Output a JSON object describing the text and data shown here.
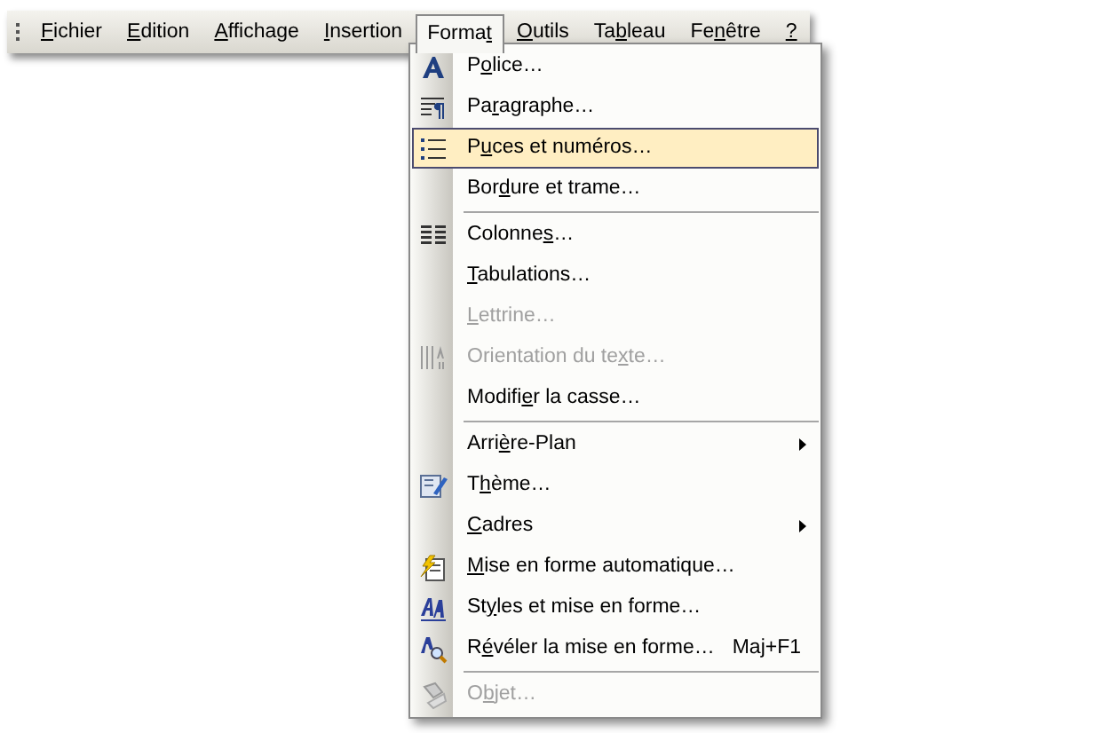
{
  "menu_bar": {
    "items": [
      {
        "label": {
          "key": "F",
          "after": "ichier"
        },
        "selected": false
      },
      {
        "label": {
          "key": "E",
          "after": "dition"
        },
        "selected": false
      },
      {
        "label": {
          "key": "A",
          "after": "ffichage"
        },
        "selected": false
      },
      {
        "label": {
          "key": "I",
          "after": "nsertion"
        },
        "selected": false
      },
      {
        "label": {
          "before": "Forma",
          "key": "t"
        },
        "selected": true
      },
      {
        "label": {
          "key": "O",
          "after": "utils"
        },
        "selected": false
      },
      {
        "label": {
          "before": "Ta",
          "key": "b",
          "after": "leau"
        },
        "selected": false
      },
      {
        "label": {
          "before": "Fe",
          "key": "n",
          "after": "être"
        },
        "selected": false
      },
      {
        "label": {
          "key": "?"
        },
        "selected": false
      }
    ]
  },
  "format_menu": {
    "items": [
      {
        "kind": "command",
        "label": {
          "before": "P",
          "key": "o",
          "after": "lice…"
        },
        "selected": false,
        "disabled": false
      },
      {
        "kind": "command",
        "label": {
          "before": "Pa",
          "key": "r",
          "after": "agraphe…"
        },
        "selected": false,
        "disabled": false
      },
      {
        "kind": "command",
        "label": {
          "before": "P",
          "key": "u",
          "after": "ces et numéros…"
        },
        "selected": true,
        "disabled": false
      },
      {
        "kind": "command",
        "label": {
          "before": "Bor",
          "key": "d",
          "after": "ure et trame…"
        },
        "selected": false,
        "disabled": false
      },
      {
        "kind": "separator"
      },
      {
        "kind": "command",
        "label": {
          "before": "Colonne",
          "key": "s",
          "after": "…"
        },
        "selected": false,
        "disabled": false
      },
      {
        "kind": "command",
        "label": {
          "key": "T",
          "after": "abulations…"
        },
        "selected": false,
        "disabled": false
      },
      {
        "kind": "command",
        "label": {
          "key": "L",
          "after": "ettrine…"
        },
        "selected": false,
        "disabled": true
      },
      {
        "kind": "command",
        "label": {
          "before": "Orientation du te",
          "key": "x",
          "after": "te…"
        },
        "selected": false,
        "disabled": true
      },
      {
        "kind": "command",
        "label": {
          "before": "Modifi",
          "key": "e",
          "after": "r la casse…"
        },
        "selected": false,
        "disabled": false
      },
      {
        "kind": "separator"
      },
      {
        "kind": "submenu",
        "label": {
          "before": "Arri",
          "key": "è",
          "after": "re-Plan"
        },
        "selected": false,
        "disabled": false
      },
      {
        "kind": "command",
        "label": {
          "before": "T",
          "key": "h",
          "after": "ème…"
        },
        "selected": false,
        "disabled": false
      },
      {
        "kind": "submenu",
        "label": {
          "key": "C",
          "after": "adres"
        },
        "selected": false,
        "disabled": false
      },
      {
        "kind": "command",
        "label": {
          "key": "M",
          "after": "ise en forme automatique…"
        },
        "selected": false,
        "disabled": false
      },
      {
        "kind": "command",
        "label": {
          "before": "St",
          "key": "y",
          "after": "les et mise en forme…"
        },
        "selected": false,
        "disabled": false
      },
      {
        "kind": "command",
        "label": {
          "before": "R",
          "key": "é",
          "after": "véler la mise en forme…"
        },
        "shortcut": "Maj+F1",
        "selected": false,
        "disabled": false
      },
      {
        "kind": "separator"
      },
      {
        "kind": "command",
        "label": {
          "before": "O",
          "key": "b",
          "after": "jet…"
        },
        "selected": false,
        "disabled": true
      }
    ]
  }
}
